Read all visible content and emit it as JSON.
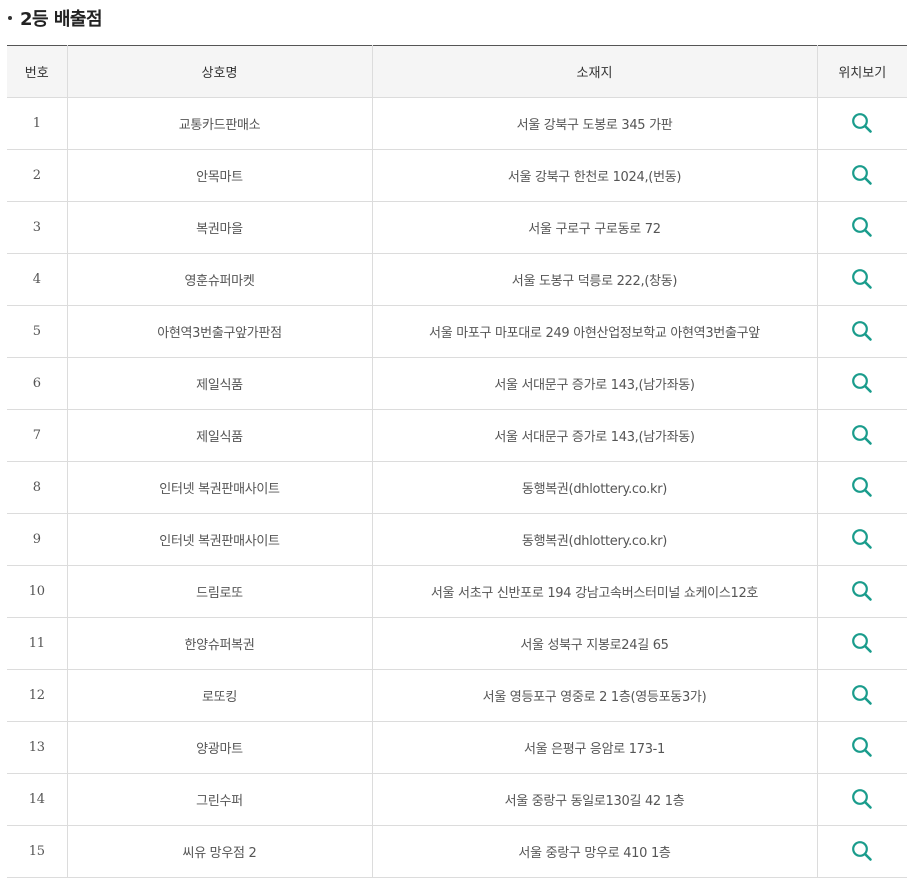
{
  "section": {
    "title": "2등 배출점"
  },
  "table": {
    "headers": {
      "no": "번호",
      "name": "상호명",
      "address": "소재지",
      "map": "위치보기"
    },
    "rows": [
      {
        "no": "1",
        "name": "교통카드판매소",
        "address": "서울 강북구 도봉로 345 가판"
      },
      {
        "no": "2",
        "name": "안목마트",
        "address": "서울 강북구 한천로 1024,(번동)"
      },
      {
        "no": "3",
        "name": "복권마을",
        "address": "서울 구로구 구로동로 72"
      },
      {
        "no": "4",
        "name": "영훈슈퍼마켓",
        "address": "서울 도봉구 덕릉로 222,(창동)"
      },
      {
        "no": "5",
        "name": "아현역3번출구앞가판점",
        "address": "서울 마포구 마포대로 249 아현산업정보학교 아현역3번출구앞"
      },
      {
        "no": "6",
        "name": "제일식품",
        "address": "서울 서대문구 증가로 143,(남가좌동)"
      },
      {
        "no": "7",
        "name": "제일식품",
        "address": "서울 서대문구 증가로 143,(남가좌동)"
      },
      {
        "no": "8",
        "name": "인터넷 복권판매사이트",
        "address": "동행복권(dhlottery.co.kr)"
      },
      {
        "no": "9",
        "name": "인터넷 복권판매사이트",
        "address": "동행복권(dhlottery.co.kr)"
      },
      {
        "no": "10",
        "name": "드림로또",
        "address": "서울 서초구 신반포로 194 강남고속버스터미널 쇼케이스12호"
      },
      {
        "no": "11",
        "name": "한양슈퍼복권",
        "address": "서울 성북구 지봉로24길 65"
      },
      {
        "no": "12",
        "name": "로또킹",
        "address": "서울 영등포구 영중로 2 1층(영등포동3가)"
      },
      {
        "no": "13",
        "name": "양광마트",
        "address": "서울 은평구 응암로 173-1"
      },
      {
        "no": "14",
        "name": "그린수퍼",
        "address": "서울 중랑구 동일로130길 42 1층"
      },
      {
        "no": "15",
        "name": "씨유 망우점 2",
        "address": "서울 중랑구 망우로 410 1층"
      }
    ],
    "map_icon": "search-icon",
    "accent_color": "#1a9c8c"
  }
}
